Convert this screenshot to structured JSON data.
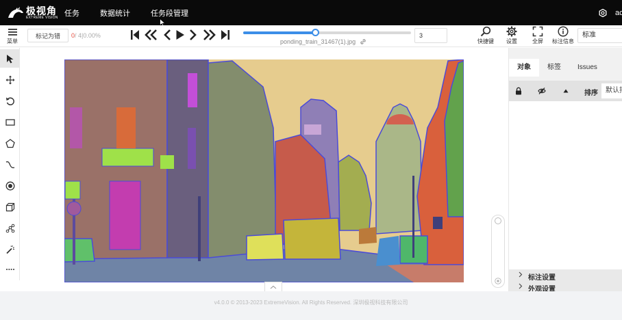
{
  "app": {
    "logo_cn": "极视角",
    "logo_en": "EXTREME VISION",
    "nav": [
      "任务",
      "数据统计",
      "任务段管理"
    ],
    "user": "ac"
  },
  "toolbar": {
    "menu_label": "菜单",
    "mark_error": "标记为错",
    "counter_current": "0",
    "counter_rest": "/ 4|0.00%",
    "progress_fraction": 0.43,
    "filename": "ponding_train_31467(1).jpg",
    "page_value": "3",
    "shortcut_label": "快捷键",
    "settings_label": "设置",
    "fullscreen_label": "全屏",
    "annotation_info_label": "标注信息",
    "label_select": "标准"
  },
  "panel": {
    "tabs": [
      "对象",
      "标签",
      "Issues"
    ],
    "sort_label": "排序",
    "sort_value": "默认排序",
    "accordion": [
      "标注设置",
      "外观设置"
    ]
  },
  "footer": {
    "copyright": "v4.0.0 © 2013-2023 ExtremeVision. All Rights Reserved. 深圳极视科技有限公司"
  },
  "colors": {
    "topbar": "#0a0a0a",
    "accent": "#3c8ee8",
    "counter": "#e64a3b"
  }
}
